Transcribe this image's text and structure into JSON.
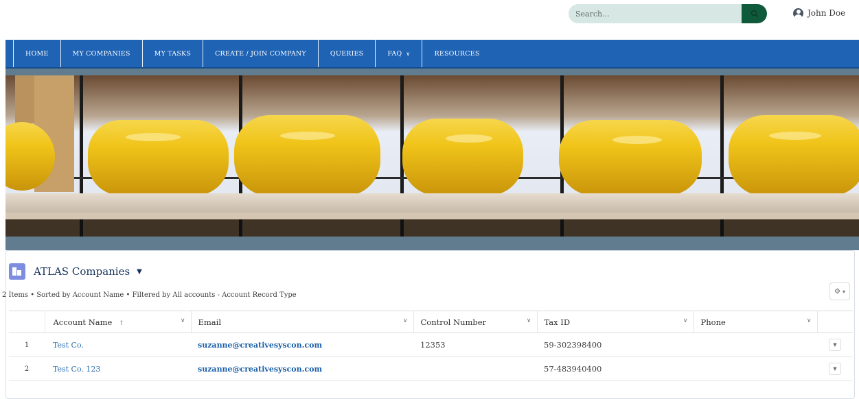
{
  "header": {
    "search": {
      "placeholder": "Search..."
    },
    "user": {
      "name": "John Doe"
    }
  },
  "nav": {
    "items": [
      {
        "label": "HOME"
      },
      {
        "label": "MY COMPANIES"
      },
      {
        "label": "MY TASKS"
      },
      {
        "label": "CREATE / JOIN COMPANY"
      },
      {
        "label": "QUERIES"
      },
      {
        "label": "FAQ",
        "has_dropdown": true
      },
      {
        "label": "RESOURCES"
      }
    ]
  },
  "hero": {
    "icon": "cheese-wheels-on-shelf-photo"
  },
  "list": {
    "title": "ATLAS Companies",
    "meta": "2 Items • Sorted by Account Name • Filtered by All accounts - Account Record Type",
    "columns": [
      "Account Name",
      "Email",
      "Control Number",
      "Tax ID",
      "Phone"
    ],
    "sort_indicator": "↑",
    "rows": [
      {
        "num": "1",
        "account_name": "Test Co.",
        "email": "suzanne@creativesyscon.com",
        "control_number": "12353",
        "tax_id": "59-302398400",
        "phone": ""
      },
      {
        "num": "2",
        "account_name": "Test Co. 123",
        "email": "suzanne@creativesyscon.com",
        "control_number": "",
        "tax_id": "57-483940400",
        "phone": ""
      }
    ]
  },
  "colors": {
    "nav_bg": "#1f63b5",
    "search_btn": "#0f5a3a",
    "search_bg": "#d7e7e3",
    "list_icon": "#7f8de1",
    "link": "#2a6fb5"
  }
}
